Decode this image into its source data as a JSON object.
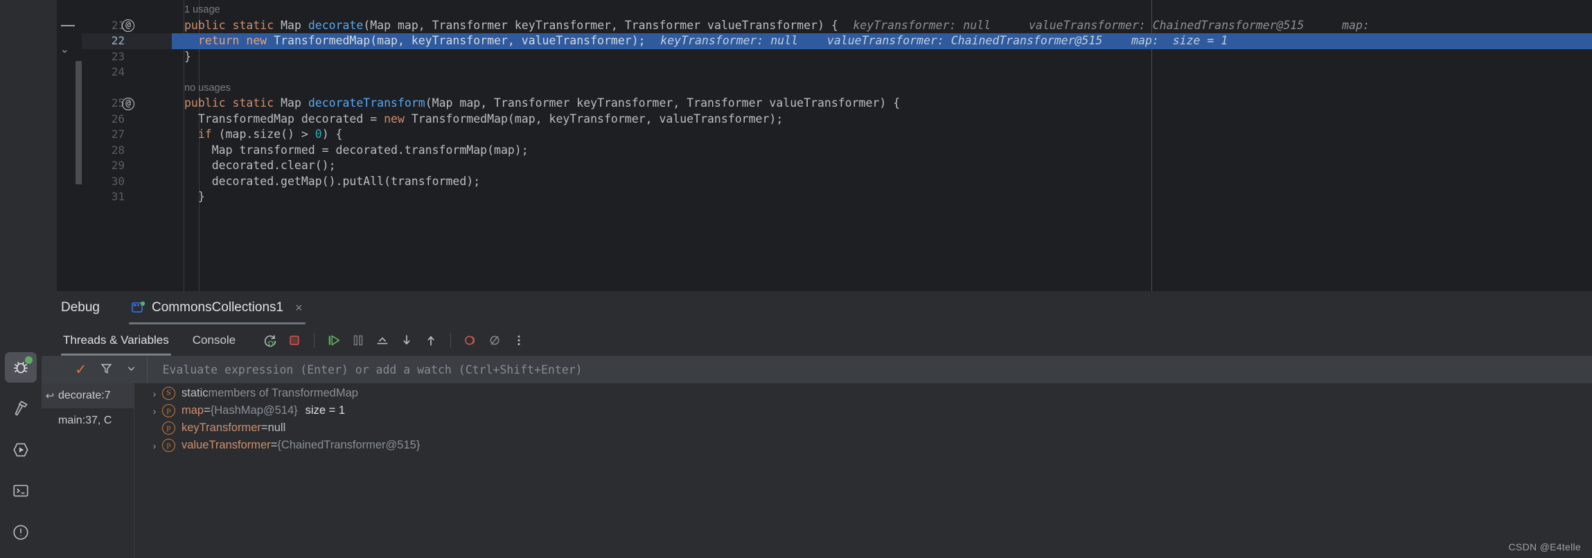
{
  "activity_bar": {
    "items": [
      {
        "name": "debug-icon",
        "label": "Debug",
        "active": true,
        "indicator": true
      },
      {
        "name": "build-hammer-icon",
        "label": "Build",
        "active": false,
        "indicator": false
      },
      {
        "name": "run-icon",
        "label": "Run",
        "active": false,
        "indicator": false
      },
      {
        "name": "terminal-icon",
        "label": "Terminal",
        "active": false,
        "indicator": false
      },
      {
        "name": "problems-icon",
        "label": "Problems",
        "active": false,
        "indicator": false
      }
    ]
  },
  "editor": {
    "lines": [
      {
        "number": "",
        "at": "",
        "kind": "usage",
        "usage": "1 usage",
        "indent": 0,
        "tokens": []
      },
      {
        "number": "21",
        "at": "@",
        "kind": "code",
        "indent": 0,
        "tokens": [
          {
            "t": "kw",
            "s": "public static "
          },
          {
            "t": "typ",
            "s": "Map "
          },
          {
            "t": "mth",
            "s": "decorate"
          },
          {
            "t": "plain",
            "s": "(Map map, Transformer keyTransformer, Transformer valueTransformer) {"
          }
        ],
        "hints": [
          {
            "s": "keyTransformer: null",
            "gap": 22
          },
          {
            "s": "valueTransformer: ChainedTransformer@515",
            "gap": 55
          },
          {
            "s": "map:",
            "gap": 55
          }
        ]
      },
      {
        "number": "22",
        "at": "",
        "kind": "code",
        "highlight": true,
        "indent": 1,
        "tokens": [
          {
            "t": "kw",
            "s": "return new "
          },
          {
            "t": "plain",
            "s": "TransformedMap(map, keyTransformer, valueTransformer);"
          }
        ],
        "hints": [
          {
            "s": "keyTransformer: null",
            "gap": 22
          },
          {
            "s": "valueTransformer: ChainedTransformer@515",
            "gap": 42
          },
          {
            "s": "map:  size = 1",
            "gap": 42
          }
        ]
      },
      {
        "number": "23",
        "at": "",
        "kind": "code",
        "indent": 0,
        "tokens": [
          {
            "t": "plain",
            "s": "}"
          }
        ]
      },
      {
        "number": "24",
        "at": "",
        "kind": "code",
        "indent": 0,
        "tokens": []
      },
      {
        "number": "",
        "at": "",
        "kind": "usage",
        "usage": "no usages",
        "indent": 0,
        "tokens": []
      },
      {
        "number": "25",
        "at": "@",
        "kind": "code",
        "indent": 0,
        "tokens": [
          {
            "t": "kw",
            "s": "public static "
          },
          {
            "t": "typ",
            "s": "Map "
          },
          {
            "t": "mth",
            "s": "decorateTransform"
          },
          {
            "t": "plain",
            "s": "(Map map, Transformer keyTransformer, Transformer valueTransformer) {"
          }
        ]
      },
      {
        "number": "26",
        "at": "",
        "kind": "code",
        "indent": 1,
        "tokens": [
          {
            "t": "plain",
            "s": "TransformedMap decorated = "
          },
          {
            "t": "kw",
            "s": "new "
          },
          {
            "t": "plain",
            "s": "TransformedMap(map, keyTransformer, valueTransformer);"
          }
        ]
      },
      {
        "number": "27",
        "at": "",
        "kind": "code",
        "indent": 1,
        "tokens": [
          {
            "t": "kw",
            "s": "if "
          },
          {
            "t": "plain",
            "s": "(map.size() > "
          },
          {
            "t": "num",
            "s": "0"
          },
          {
            "t": "plain",
            "s": ") {"
          }
        ]
      },
      {
        "number": "28",
        "at": "",
        "kind": "code",
        "indent": 2,
        "tokens": [
          {
            "t": "plain",
            "s": "Map transformed = decorated.transformMap(map);"
          }
        ]
      },
      {
        "number": "29",
        "at": "",
        "kind": "code",
        "indent": 2,
        "tokens": [
          {
            "t": "plain",
            "s": "decorated.clear();"
          }
        ]
      },
      {
        "number": "30",
        "at": "",
        "kind": "code",
        "indent": 2,
        "tokens": [
          {
            "t": "plain",
            "s": "decorated.getMap().putAll(transformed);"
          }
        ]
      },
      {
        "number": "31",
        "at": "",
        "kind": "code",
        "indent": 1,
        "tokens": [
          {
            "t": "plain",
            "s": "}"
          }
        ]
      }
    ]
  },
  "debug_window": {
    "title": "Debug",
    "tab": {
      "label": "CommonsCollections1",
      "close_label": "×",
      "running_indicator": true
    },
    "toolbar": {
      "tabs": [
        {
          "label": "Threads & Variables",
          "selected": true
        },
        {
          "label": "Console",
          "selected": false
        }
      ],
      "icons": [
        {
          "name": "rerun-debug-icon",
          "title": "Rerun"
        },
        {
          "name": "stop-icon",
          "title": "Stop"
        },
        {
          "name": "resume-program-icon",
          "title": "Resume Program"
        },
        {
          "name": "pause-program-icon",
          "title": "Pause Program"
        },
        {
          "name": "step-over-icon",
          "title": "Step Over"
        },
        {
          "name": "step-into-icon",
          "title": "Step Into"
        },
        {
          "name": "step-out-icon",
          "title": "Step Out"
        },
        {
          "name": "view-breakpoints-icon",
          "title": "View Breakpoints"
        },
        {
          "name": "mute-breakpoints-icon",
          "title": "Mute Breakpoints"
        },
        {
          "name": "more-options-icon",
          "title": "More"
        }
      ]
    },
    "evaluate": {
      "placeholder": "Evaluate expression (Enter) or add a watch (Ctrl+Shift+Enter)",
      "value": "",
      "check_glyph": "✓",
      "filter_glyph": "filter-icon",
      "chevron_glyph": "˅"
    },
    "frames": [
      {
        "icon": "↩",
        "label": "decorate:7",
        "selected": true
      },
      {
        "icon": "",
        "label": "main:37, C",
        "selected": false
      }
    ],
    "variables": [
      {
        "expandable": true,
        "badge": "S",
        "name": "static",
        "name_style": "plain",
        "suffix": " members of TransformedMap",
        "suffix_style": "gray",
        "eq": "",
        "value": "",
        "extra": ""
      },
      {
        "expandable": true,
        "badge": "p",
        "name": "map",
        "name_style": "field",
        "suffix": "",
        "eq": " = ",
        "value": "{HashMap@514}",
        "value_style": "ref",
        "extra": "size = 1"
      },
      {
        "expandable": false,
        "badge": "p",
        "name": "keyTransformer",
        "name_style": "field",
        "suffix": "",
        "eq": " = ",
        "value": "null",
        "value_style": "plain",
        "extra": ""
      },
      {
        "expandable": true,
        "badge": "p",
        "name": "valueTransformer",
        "name_style": "field",
        "suffix": "",
        "eq": " = ",
        "value": "{ChainedTransformer@515}",
        "value_style": "ref",
        "extra": ""
      }
    ]
  },
  "watermark": "CSDN @E4telle",
  "colors": {
    "editor_bg": "#1e1f22",
    "panel_bg": "#2b2d30",
    "selection_blue": "#2f5b9e",
    "keyword_orange": "#cf8e6d",
    "method_blue": "#56a8f5",
    "number_teal": "#2aacb8",
    "hint_gray": "#8a8f98",
    "accent_orange": "#e8703a",
    "run_green": "#5fad65",
    "stop_red": "#c75450"
  }
}
